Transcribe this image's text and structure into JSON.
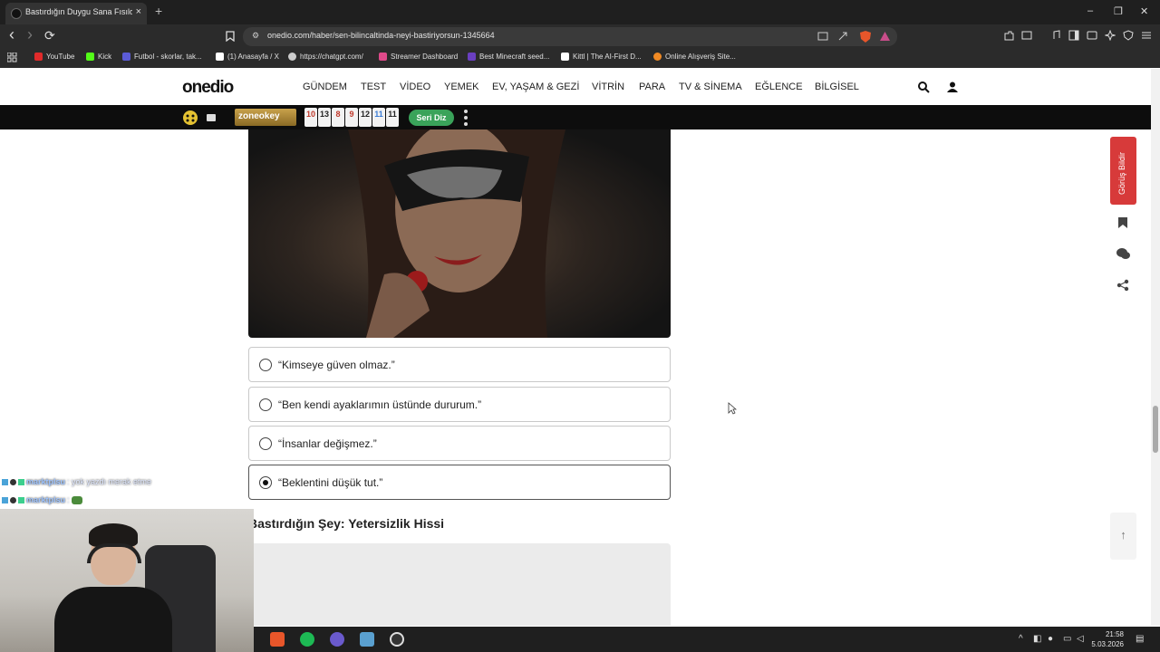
{
  "browser": {
    "tab_title": "Bastırdığın Duygu Sana Fısıldıyo",
    "new_tab_label": "+",
    "url": "onedio.com/haber/sen-bilincaltinda-neyi-bastiriyorsun-1345664",
    "window_controls": {
      "minimize": "–",
      "restore": "❐",
      "close": "✕"
    },
    "nav": {
      "back": "‹",
      "forward": "›",
      "reload": "⟳"
    }
  },
  "bookmarks": [
    {
      "label": "YouTube",
      "color": "#e02a2a"
    },
    {
      "label": "Kick",
      "color": "#53fc18"
    },
    {
      "label": "Futbol - skorlar, tak...",
      "color": "#5b5bd6"
    },
    {
      "label": "(1) Anasayfa / X",
      "color": "#ffffff"
    },
    {
      "label": "https://chatgpt.com/",
      "color": "#cccccc"
    },
    {
      "label": "Streamer Dashboard",
      "color": "#e04a8a"
    },
    {
      "label": "Best Minecraft seed...",
      "color": "#6a3fc1"
    },
    {
      "label": "Kittl | The AI-First D...",
      "color": "#ffffff"
    },
    {
      "label": "Online Alışveriş Site...",
      "color": "#f08a24"
    }
  ],
  "site": {
    "logo": "onedio",
    "nav_items": [
      "GÜNDEM",
      "TEST",
      "VİDEO",
      "YEMEK",
      "EV, YAŞAM & GEZİ",
      "VİTRİN",
      "PARA",
      "TV & SİNEMA",
      "EĞLENCE",
      "BİLGİSEL"
    ],
    "ad": {
      "brand": "zoneokey",
      "tiles": [
        {
          "n": "10",
          "color": "#c0392b"
        },
        {
          "n": "13",
          "color": "#222222"
        },
        {
          "n": "8",
          "color": "#c0392b"
        },
        {
          "n": "9",
          "color": "#c0392b"
        },
        {
          "n": "12",
          "color": "#222222"
        },
        {
          "n": "11",
          "color": "#3a7bd5"
        },
        {
          "n": "11",
          "color": "#222222"
        }
      ],
      "cta": "Seri Diz"
    }
  },
  "quiz": {
    "options": [
      {
        "label": "“Kimseye güven olmaz.”",
        "selected": false
      },
      {
        "label": "“Ben kendi ayaklarımın üstünde dururum.”",
        "selected": false
      },
      {
        "label": "“İnsanlar değişmez.”",
        "selected": false
      },
      {
        "label": "“Beklentini düşük tut.”",
        "selected": true
      }
    ],
    "next_section_title": "Bastırdığın Şey: Yetersizlik Hissi"
  },
  "sidebar": {
    "feedback_label": "Görüş Bildir",
    "scroll_top": "↑"
  },
  "chat": [
    {
      "user": "marktplsu",
      "message": ": yok yazdı merak etme"
    },
    {
      "user": "marktplsu",
      "message": ":"
    }
  ],
  "taskbar": {
    "time": "21:58",
    "date": "5.03.2026"
  }
}
